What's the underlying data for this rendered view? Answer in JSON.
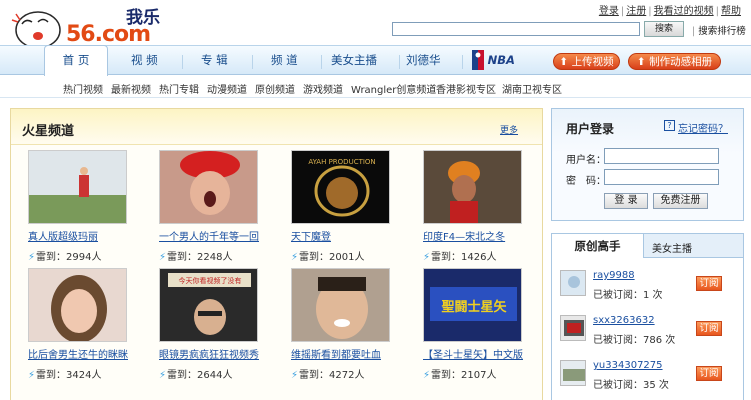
{
  "header": {
    "logo_text": "我乐",
    "logo_domain": "56.com",
    "top_links": [
      "登录",
      "注册",
      "我看过的视频",
      "帮助"
    ],
    "search_placeholder": "",
    "search_button": "搜索",
    "rank_link": "搜索排行榜"
  },
  "nav": {
    "tabs": [
      "首 页",
      "视 频",
      "专 辑",
      "频 道",
      "美女主播",
      "刘德华",
      "NBA"
    ],
    "upload_button": "上传视频",
    "album_button": "制作动感相册"
  },
  "subnav": [
    "热门视频",
    "最新视频",
    "热门专辑",
    "动漫频道",
    "原创频道",
    "游戏频道",
    "Wrangler创意频道",
    "香港影视专区",
    "湖南卫视专区"
  ],
  "main": {
    "title": "火星频道",
    "more": "更多",
    "videos": [
      {
        "title": "真人版超级玛丽",
        "count": "雷到：2994人"
      },
      {
        "title": "一个男人的千年等一回",
        "count": "雷到：2248人"
      },
      {
        "title": "天下魔登",
        "count": "雷到：2001人"
      },
      {
        "title": "印度F4—宋北之冬",
        "count": "雷到：1426人"
      },
      {
        "title": "比后舍男生还牛的眯眯",
        "count": "雷到：3424人"
      },
      {
        "title": "眼镜男疯疯狂狂视频秀",
        "count": "雷到：2644人"
      },
      {
        "title": "维摇斯看到都要吐血",
        "count": "雷到：4272人"
      },
      {
        "title": "【圣斗士星矢】中文版",
        "count": "雷到：2107人"
      }
    ],
    "thumb_captions": {
      "mgm": "AYAH PRODUCTION",
      "glasses": "今天你看视频了没有",
      "saint": "聖闘士星矢"
    }
  },
  "login": {
    "title": "用户登录",
    "forgot": "忘记密码？",
    "username_label": "用户名：",
    "password_label": "密　码：",
    "login_button": "登 录",
    "register_button": "免费注册"
  },
  "experts": {
    "tab_active": "原创高手",
    "tab_other": "美女主播",
    "users": [
      {
        "name": "ray9988",
        "sub": "已被订阅：1 次",
        "button": "订阅"
      },
      {
        "name": "sxx3263632",
        "sub": "已被订阅：786 次",
        "button": "订阅"
      },
      {
        "name": "yu334307275",
        "sub": "已被订阅：35 次",
        "button": "订阅"
      }
    ]
  },
  "colors": {
    "brand_orange": "#e24a14",
    "nav_blue": "#184d8c",
    "link_blue": "#1a4fa0"
  }
}
